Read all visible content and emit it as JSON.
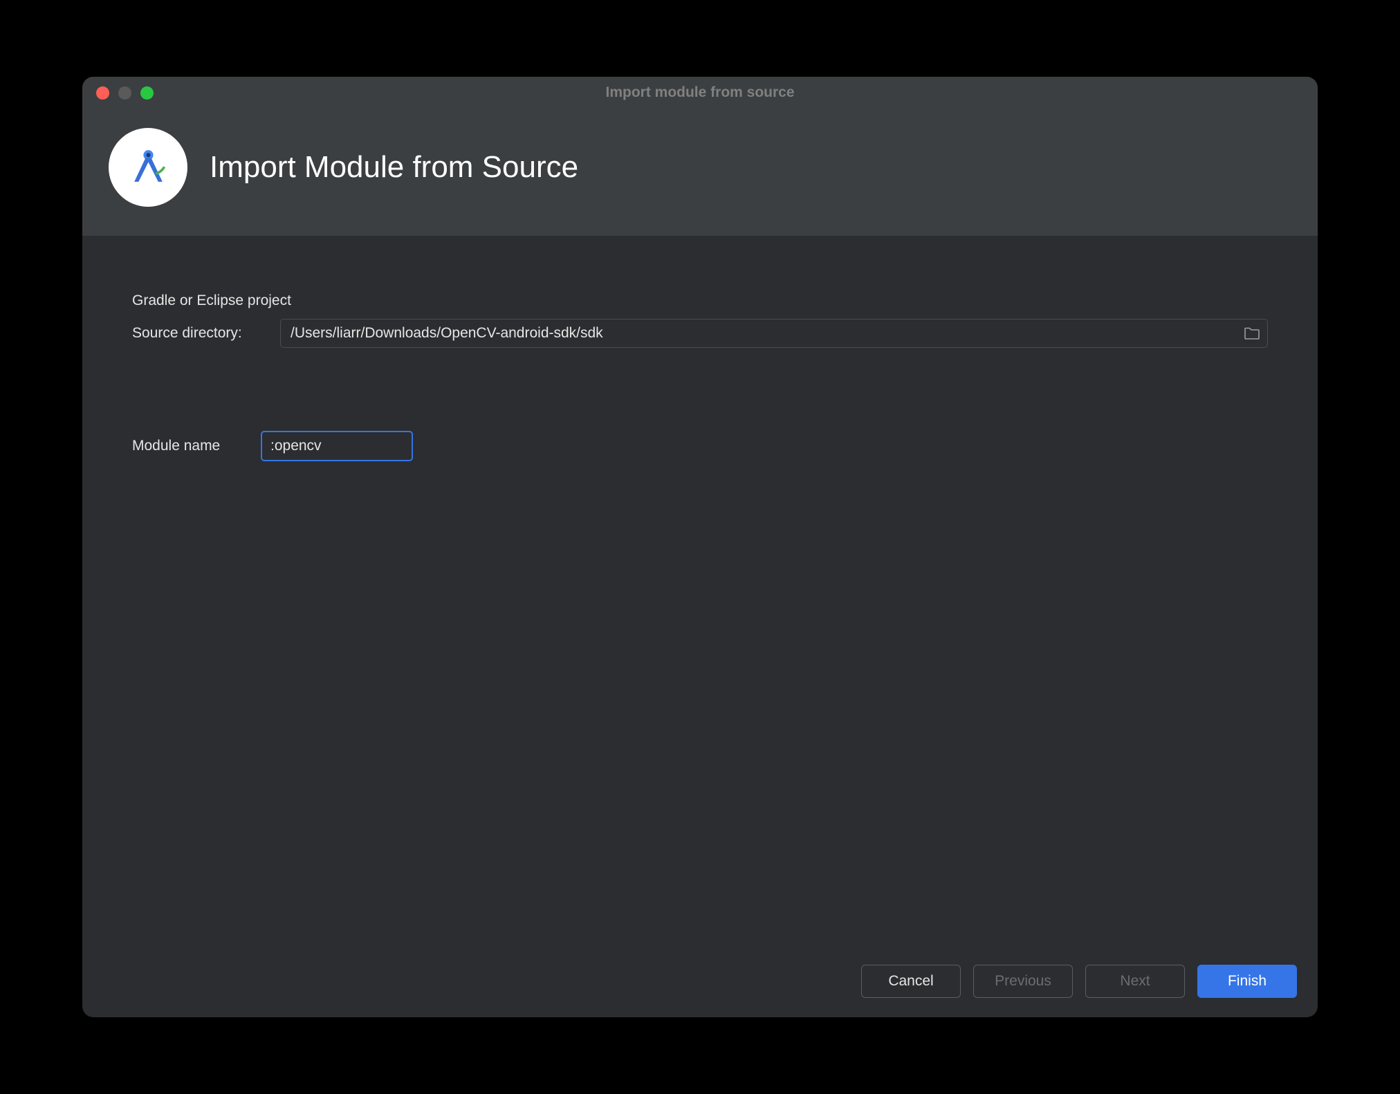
{
  "window": {
    "title": "Import module from source"
  },
  "header": {
    "title": "Import Module from Source"
  },
  "form": {
    "section_label": "Gradle or Eclipse project",
    "source_directory_label": "Source directory:",
    "source_directory_value": "/Users/liarr/Downloads/OpenCV-android-sdk/sdk",
    "module_name_label": "Module name",
    "module_name_value": ":opencv"
  },
  "footer": {
    "cancel": "Cancel",
    "previous": "Previous",
    "next": "Next",
    "finish": "Finish"
  }
}
